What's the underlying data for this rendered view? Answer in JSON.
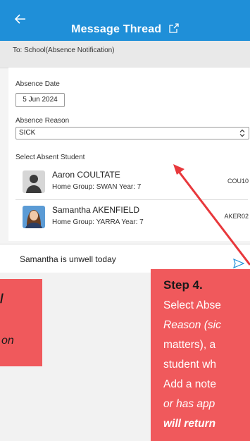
{
  "header": {
    "title": "Message Thread"
  },
  "to_line": "To: School(Absence Notification)",
  "form": {
    "absence_date_label": "Absence Date",
    "absence_date_value": "5 Jun 2024",
    "absence_reason_label": "Absence Reason",
    "absence_reason_value": "SICK",
    "select_student_label": "Select Absent Student"
  },
  "students": [
    {
      "name": "Aaron COULTATE",
      "meta": "Home Group: SWAN Year: 7",
      "code": "COU10"
    },
    {
      "name": "Samantha AKENFIELD",
      "meta": "Home Group: YARRA Year: 7",
      "code": "AKER02"
    }
  ],
  "note": "Samantha is unwell today",
  "left_callout": {
    "fragment_top": "/",
    "fragment_bottom": "on"
  },
  "step_callout": {
    "title": "Step 4.",
    "lines": [
      "Select Abse",
      "Reason (sic",
      "matters), a",
      "student wh",
      "Add a note",
      "or has app",
      "will return"
    ]
  },
  "colors": {
    "header": "#1f8fd8",
    "callout": "#f0595c",
    "arrow": "#e8383c"
  }
}
